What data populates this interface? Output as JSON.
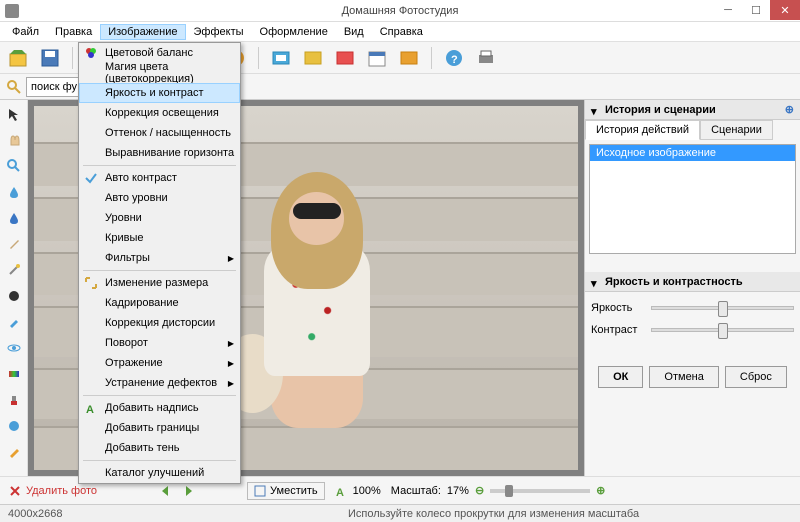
{
  "app": {
    "title": "Домашняя Фотостудия"
  },
  "menubar": [
    "Файл",
    "Правка",
    "Изображение",
    "Эффекты",
    "Оформление",
    "Вид",
    "Справка"
  ],
  "menubar_open_index": 2,
  "search": {
    "placeholder": "поиск фу"
  },
  "dropdown": {
    "groups": [
      [
        {
          "label": "Цветовой баланс",
          "icon": "color-balance"
        },
        {
          "label": "Магия цвета (цветокоррекция)"
        },
        {
          "label": "Яркость и контраст",
          "highlighted": true
        },
        {
          "label": "Коррекция освещения"
        },
        {
          "label": "Оттенок / насыщенность"
        },
        {
          "label": "Выравнивание горизонта"
        }
      ],
      [
        {
          "label": "Авто контраст",
          "icon": "check"
        },
        {
          "label": "Авто уровни"
        },
        {
          "label": "Уровни"
        },
        {
          "label": "Кривые"
        },
        {
          "label": "Фильтры",
          "submenu": true
        }
      ],
      [
        {
          "label": "Изменение размера",
          "icon": "resize"
        },
        {
          "label": "Кадрирование"
        },
        {
          "label": "Коррекция дисторсии"
        },
        {
          "label": "Поворот",
          "submenu": true
        },
        {
          "label": "Отражение",
          "submenu": true
        },
        {
          "label": "Устранение дефектов",
          "submenu": true
        }
      ],
      [
        {
          "label": "Добавить надпись",
          "icon": "text"
        },
        {
          "label": "Добавить границы"
        },
        {
          "label": "Добавить тень"
        }
      ],
      [
        {
          "label": "Каталог улучшений"
        }
      ]
    ]
  },
  "right_panel": {
    "header1": "История и сценарии",
    "tabs": [
      "История действий",
      "Сценарии"
    ],
    "active_tab": 0,
    "history": [
      "Исходное изображение"
    ],
    "header2": "Яркость и контрастность",
    "sliders": [
      {
        "label": "Яркость"
      },
      {
        "label": "Контраст"
      }
    ],
    "buttons": [
      "ОК",
      "Отмена",
      "Сброс"
    ]
  },
  "bottom": {
    "delete": "Удалить фото",
    "fit": "Уместить",
    "zoom_actual": "100%",
    "scale_label": "Масштаб:",
    "scale_value": "17%"
  },
  "status": {
    "dimensions": "4000x2668",
    "hint": "Используйте колесо прокрутки для изменения масштаба"
  }
}
